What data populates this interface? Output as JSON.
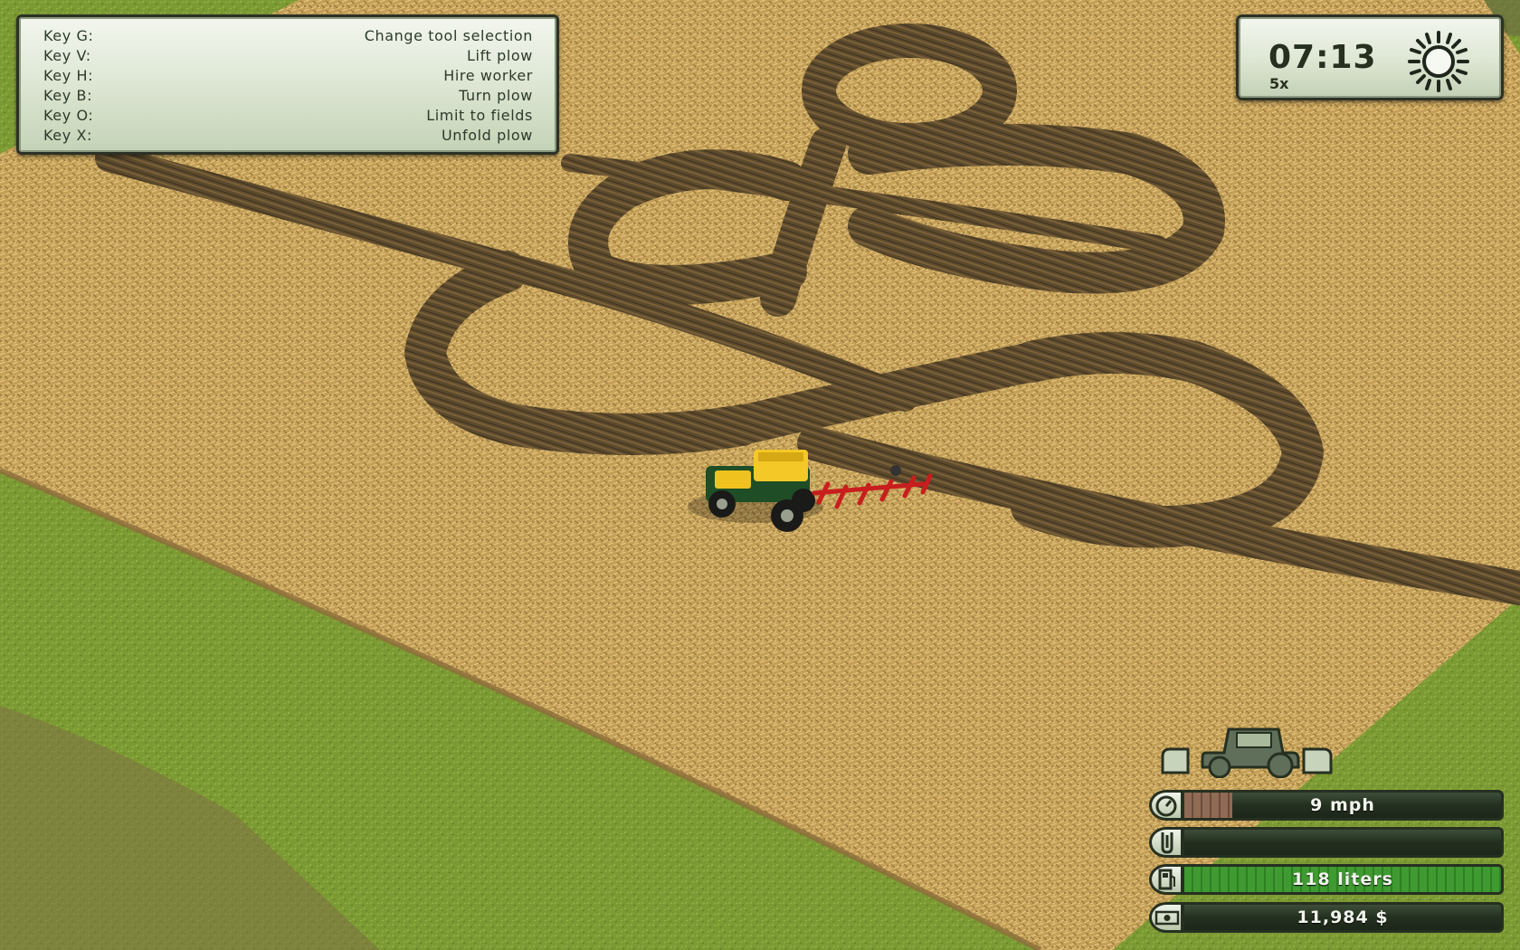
{
  "help": {
    "rows": [
      {
        "key": "Key G:",
        "action": "Change tool selection"
      },
      {
        "key": "Key V:",
        "action": "Lift plow"
      },
      {
        "key": "Key H:",
        "action": "Hire worker"
      },
      {
        "key": "Key B:",
        "action": "Turn plow"
      },
      {
        "key": "Key O:",
        "action": "Limit to fields"
      },
      {
        "key": "Key X:",
        "action": "Unfold plow"
      }
    ]
  },
  "clock": {
    "time": "07:13",
    "speed": "5x",
    "weather_icon": "sun-icon"
  },
  "hud": {
    "vehicle_icon": "tractor-icon",
    "speed": {
      "icon": "speedometer-icon",
      "text": "9 mph",
      "fill": 0.15
    },
    "tool": {
      "icon": "tool-level-icon",
      "text": "",
      "fill": 0
    },
    "fuel": {
      "icon": "fuel-pump-icon",
      "text": "118 liters",
      "fill": 1.0
    },
    "money": {
      "icon": "cash-icon",
      "text": "11,984 $"
    }
  },
  "colors": {
    "grass": "#7e9a34",
    "crop": "#c6a25a",
    "plowed": "#5d4a2c",
    "hud_dark": "#24301f",
    "fuel_green": "#3f9a31"
  }
}
